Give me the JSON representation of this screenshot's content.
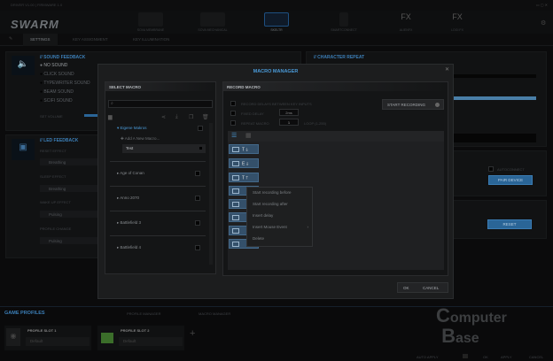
{
  "window": {
    "title": "DRIVER V1.00 | FIRMWARE 1.0"
  },
  "brand": {
    "logo": "ROCCAT SWARM"
  },
  "devices": [
    {
      "label": "SOVA MEMBRANE"
    },
    {
      "label": "SOVA MECHANICAL"
    },
    {
      "label": "SKELTR",
      "active": true
    },
    {
      "label": "SMARTCONNECT"
    },
    {
      "label": "ALIENFX"
    },
    {
      "label": "LOGI FX"
    }
  ],
  "tabs": [
    {
      "label": "SETTINGS",
      "active": true
    },
    {
      "label": "KEY ASSIGNMENT"
    },
    {
      "label": "KEY ILLUMINATION"
    }
  ],
  "sound_feedback": {
    "title": "// SOUND FEEDBACK",
    "options": [
      "NO SOUND",
      "CLICK SOUND",
      "TYPEWRITER SOUND",
      "BEAM SOUND",
      "SCIFI SOUND"
    ],
    "selected": "NO SOUND",
    "volume_label": "SET VOLUME"
  },
  "led_feedback": {
    "title": "// LED FEEDBACK",
    "fields": [
      {
        "label": "RESET EFFECT",
        "value": "Breathing"
      },
      {
        "label": "SLEEP EFFECT",
        "value": "Breathing"
      },
      {
        "label": "WAKE UP EFFECT",
        "value": "Pulsing"
      },
      {
        "label": "PROFILE CHANGE",
        "value": "Pulsing"
      }
    ]
  },
  "character_repeat": {
    "title": "// CHARACTER REPEAT"
  },
  "smartconnect": {
    "autoconnect_label": "AUTOCONNECT",
    "pair_label": "PAIR DEVICE"
  },
  "reset": {
    "label": "RESET"
  },
  "macro_manager": {
    "title": "MACRO MANAGER",
    "select_macro": {
      "title": "SELECT MACRO",
      "search_placeholder": "",
      "group": "Eigene Makros",
      "add_label": "Add A New Macro...",
      "selected_macro": "Test",
      "groups": [
        "Age of Conan",
        "Anno 2070",
        "Battlefield 3",
        "Battlefield 4"
      ]
    },
    "record_macro": {
      "title": "RECORD MACRO",
      "record_delays_label": "RECORD DELAYS BETWEEN KEY INPUTS",
      "fixed_delay_label": "FIXED DELAY",
      "fixed_delay_value": "2ms",
      "repeat_label": "REPEAT MACRO",
      "repeat_value": "1",
      "loop_label": "LOOP (1-255)",
      "start_label": "START RECORDING",
      "steps": [
        {
          "key": "T",
          "dir": "down"
        },
        {
          "key": "E",
          "dir": "down"
        },
        {
          "key": "T",
          "dir": "up"
        },
        {
          "key": "",
          "dir": ""
        },
        {
          "key": "",
          "dir": ""
        },
        {
          "key": "",
          "dir": ""
        },
        {
          "key": "",
          "dir": ""
        },
        {
          "key": "",
          "dir": ""
        }
      ]
    },
    "context_menu": [
      "Start recording before",
      "Start recording after",
      "Insert delay",
      "Insert Mouse Event",
      "Delete"
    ],
    "ok_label": "OK",
    "cancel_label": "CANCEL"
  },
  "game_profiles": {
    "title": "GAME PROFILES",
    "tabs": [
      "PROFILE MANAGER",
      "MACRO MANAGER"
    ],
    "slots": [
      {
        "label": "PROFILE SLOT 1",
        "value": "Default"
      },
      {
        "label": "PROFILE SLOT 2",
        "value": "Default"
      }
    ]
  },
  "footer": {
    "auto_apply": "AUTO APPLY",
    "ok": "OK",
    "apply": "APPLY",
    "cancel": "CANCEL"
  },
  "watermark": "ComputerBase",
  "colors": {
    "accent": "#3c7fb8",
    "macro_step": "#34506a"
  }
}
